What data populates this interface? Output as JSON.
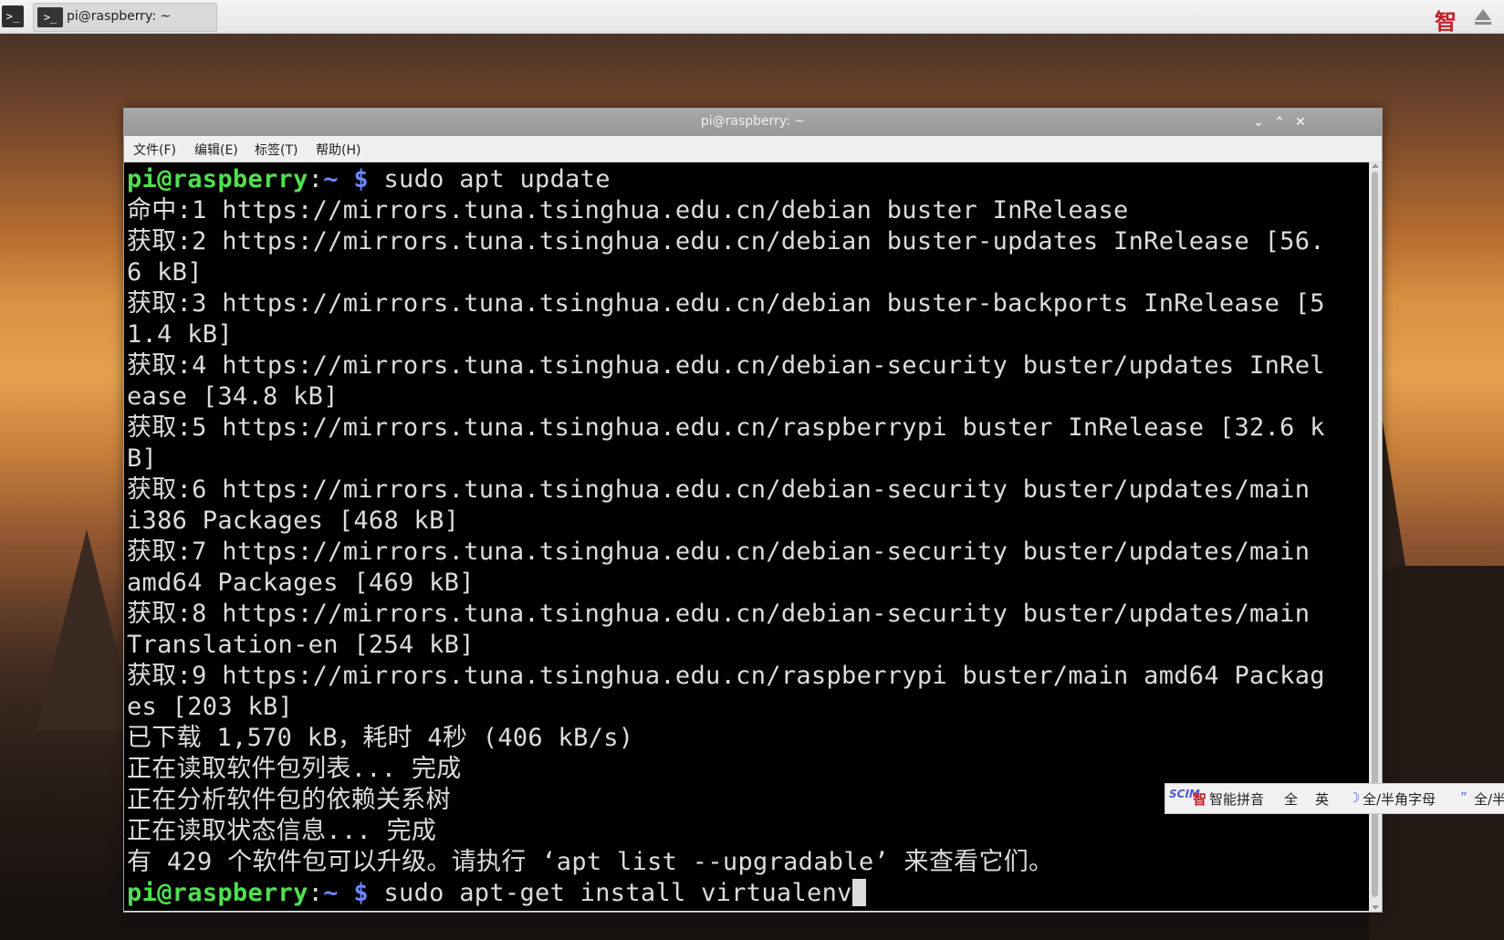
{
  "taskbar": {
    "launcher_icon": "terminal-icon",
    "task_label": "pi@raspberry: ~",
    "tray_ime_glyph": "智",
    "tray_eject_icon": "eject-icon"
  },
  "window": {
    "title": "pi@raspberry: ~",
    "buttons": {
      "minimize": "⌄",
      "maximize": "⌃",
      "close": "✕"
    },
    "menu": [
      "文件(F)",
      "编辑(E)",
      "标签(T)",
      "帮助(H)"
    ]
  },
  "terminal": {
    "prompt_user": "pi@raspberry",
    "prompt_colon": ":",
    "prompt_path": "~ $",
    "command_1": " sudo apt update",
    "output": [
      "命中:1 https://mirrors.tuna.tsinghua.edu.cn/debian buster InRelease",
      "获取:2 https://mirrors.tuna.tsinghua.edu.cn/debian buster-updates InRelease [56.",
      "6 kB]",
      "获取:3 https://mirrors.tuna.tsinghua.edu.cn/debian buster-backports InRelease [5",
      "1.4 kB]",
      "获取:4 https://mirrors.tuna.tsinghua.edu.cn/debian-security buster/updates InRel",
      "ease [34.8 kB]",
      "获取:5 https://mirrors.tuna.tsinghua.edu.cn/raspberrypi buster InRelease [32.6 k",
      "B]",
      "获取:6 https://mirrors.tuna.tsinghua.edu.cn/debian-security buster/updates/main",
      "i386 Packages [468 kB]",
      "获取:7 https://mirrors.tuna.tsinghua.edu.cn/debian-security buster/updates/main",
      "amd64 Packages [469 kB]",
      "获取:8 https://mirrors.tuna.tsinghua.edu.cn/debian-security buster/updates/main",
      "Translation-en [254 kB]",
      "获取:9 https://mirrors.tuna.tsinghua.edu.cn/raspberrypi buster/main amd64 Packag",
      "es [203 kB]",
      "已下载 1,570 kB，耗时 4秒 (406 kB/s)",
      "正在读取软件包列表... 完成",
      "正在分析软件包的依赖关系树",
      "正在读取状态信息... 完成",
      "有 429 个软件包可以升级。请执行 ‘apt list --upgradable’ 来查看它们。"
    ],
    "command_2": " sudo apt-get install virtualenv",
    "colors": {
      "user": "#4fe04f",
      "path": "#6c86ff",
      "text": "#dcdcdc",
      "background": "#000000"
    }
  },
  "ime": {
    "logo": "SCIM",
    "zhi": "智",
    "mode": "智能拼音",
    "full": "全",
    "english": "英",
    "width_mode": "全/半角字母",
    "punct_mode": "全/半"
  }
}
